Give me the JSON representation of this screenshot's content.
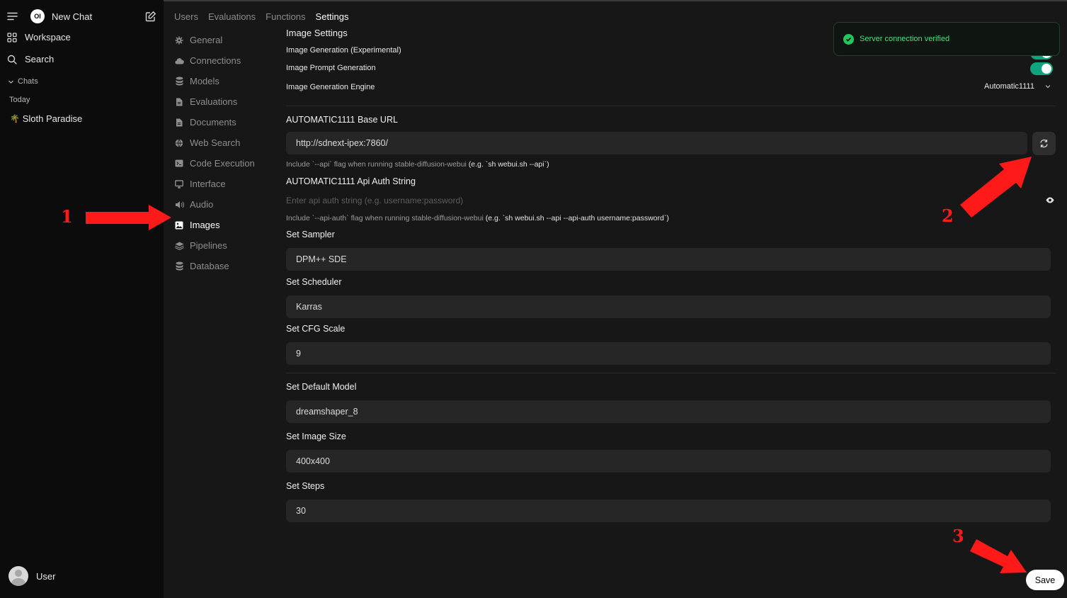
{
  "sidebar": {
    "new_chat": "New Chat",
    "logo_text": "OI",
    "workspace": "Workspace",
    "search": "Search",
    "chats": "Chats",
    "today": "Today",
    "chat_item": "Sloth Paradise",
    "chat_item_emoji": "🌴",
    "user": "User"
  },
  "top_tabs": [
    "Users",
    "Evaluations",
    "Functions",
    "Settings"
  ],
  "active_tab": "Settings",
  "settings_nav": [
    {
      "label": "General",
      "icon": "gear-icon"
    },
    {
      "label": "Connections",
      "icon": "cloud-icon"
    },
    {
      "label": "Models",
      "icon": "database-icon"
    },
    {
      "label": "Evaluations",
      "icon": "document-icon"
    },
    {
      "label": "Documents",
      "icon": "document-icon"
    },
    {
      "label": "Web Search",
      "icon": "globe-icon"
    },
    {
      "label": "Code Execution",
      "icon": "terminal-icon"
    },
    {
      "label": "Interface",
      "icon": "monitor-icon"
    },
    {
      "label": "Audio",
      "icon": "speaker-icon"
    },
    {
      "label": "Images",
      "icon": "image-icon"
    },
    {
      "label": "Pipelines",
      "icon": "layers-icon"
    },
    {
      "label": "Database",
      "icon": "database-icon"
    }
  ],
  "active_nav": "Images",
  "image_settings": {
    "title": "Image Settings",
    "gen_label": "Image Generation (Experimental)",
    "prompt_gen_label": "Image Prompt Generation",
    "engine_label": "Image Generation Engine",
    "engine_value": "Automatic1111"
  },
  "base_url": {
    "label": "AUTOMATIC1111 Base URL",
    "value": "http://sdnext-ipex:7860/",
    "hint_pre": "Include `--api` flag when running stable-diffusion-webui",
    "hint_code": "(e.g. `sh webui.sh --api`)"
  },
  "auth": {
    "label": "AUTOMATIC1111 Api Auth String",
    "placeholder": "Enter api auth string (e.g. username:password)",
    "hint_pre": "Include `--api-auth` flag when running stable-diffusion-webui",
    "hint_code": "(e.g. `sh webui.sh --api --api-auth username:password`)"
  },
  "sampler": {
    "label": "Set Sampler",
    "value": "DPM++ SDE"
  },
  "scheduler": {
    "label": "Set Scheduler",
    "value": "Karras"
  },
  "cfg": {
    "label": "Set CFG Scale",
    "value": "9"
  },
  "model": {
    "label": "Set Default Model",
    "value": "dreamshaper_8"
  },
  "size": {
    "label": "Set Image Size",
    "value": "400x400"
  },
  "steps": {
    "label": "Set Steps",
    "value": "30"
  },
  "toast": {
    "message": "Server connection verified"
  },
  "save_label": "Save",
  "annotations": [
    "1",
    "2",
    "3"
  ],
  "colors": {
    "toggle_on": "#10a37f",
    "toast_text": "#4ade80",
    "annotation": "#ff1a1a",
    "sidebar_bg": "#0c0c0c",
    "main_bg": "#171717"
  }
}
